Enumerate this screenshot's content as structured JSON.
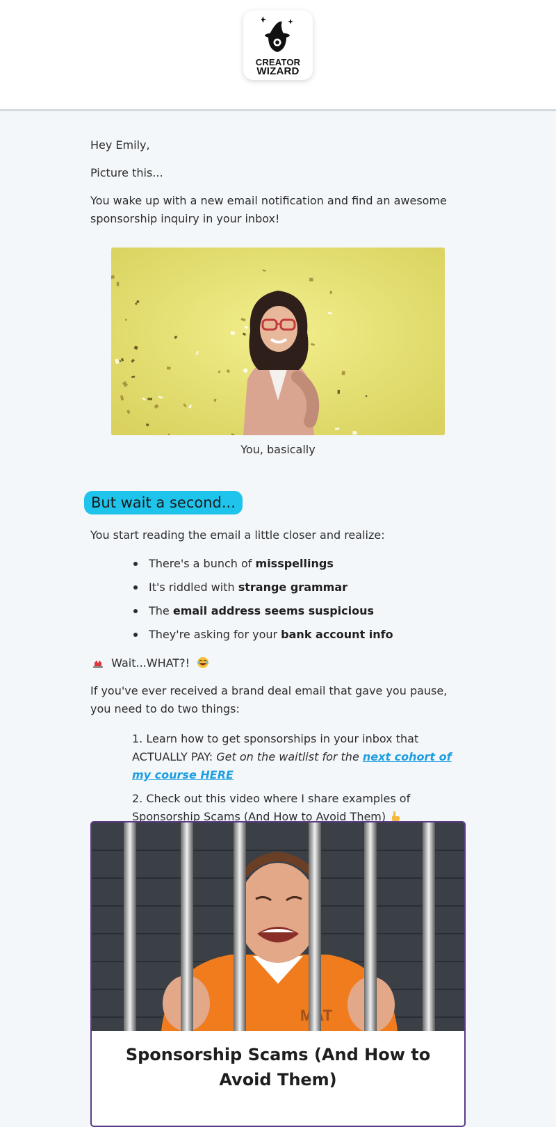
{
  "brand": {
    "logo_line1": "CREATOR",
    "logo_line2": "WIZARD"
  },
  "email": {
    "greeting": "Hey Emily,",
    "intro": "Picture this...",
    "para1": "You wake up with a new email notification and find an awesome sponsorship inquiry in your inbox!",
    "gif_caption": "You, basically",
    "section_heading": "But wait a second...",
    "para2": "You start reading the email a little closer and realize:",
    "bullets": [
      {
        "pre": "There's a bunch of ",
        "bold": "misspellings"
      },
      {
        "pre": "It's riddled with ",
        "bold": "strange grammar"
      },
      {
        "pre": "The ",
        "bold": "email address seems suspicious"
      },
      {
        "pre": "They're asking for your ",
        "bold": "bank account info"
      }
    ],
    "wait_text": "Wait...WHAT?!",
    "para3": "If you've ever received a brand deal email that gave you pause, you need to do two things:",
    "steps": {
      "step1_text": "1. Learn how to get sponsorships in your inbox that ACTUALLY PAY: ",
      "step1_italic": "Get on the waitlist for the ",
      "step1_link": "next cohort of my course HERE",
      "step2_text": "2. Check out this video where I share examples of Sponsorship Scams (And How to Avoid Them)"
    },
    "video_card": {
      "title": "Sponsorship Scams (And How to Avoid Them)",
      "shirt_text": "MAT"
    }
  },
  "icons": [
    "wizard-logo-icon",
    "siren-icon",
    "laughing-face-icon",
    "pointing-down-icon"
  ],
  "colors": {
    "accent_pill": "#1ec4ec",
    "link": "#1e9ee0",
    "card_border": "#5b3a86",
    "page_bg": "#f4f7fa"
  }
}
